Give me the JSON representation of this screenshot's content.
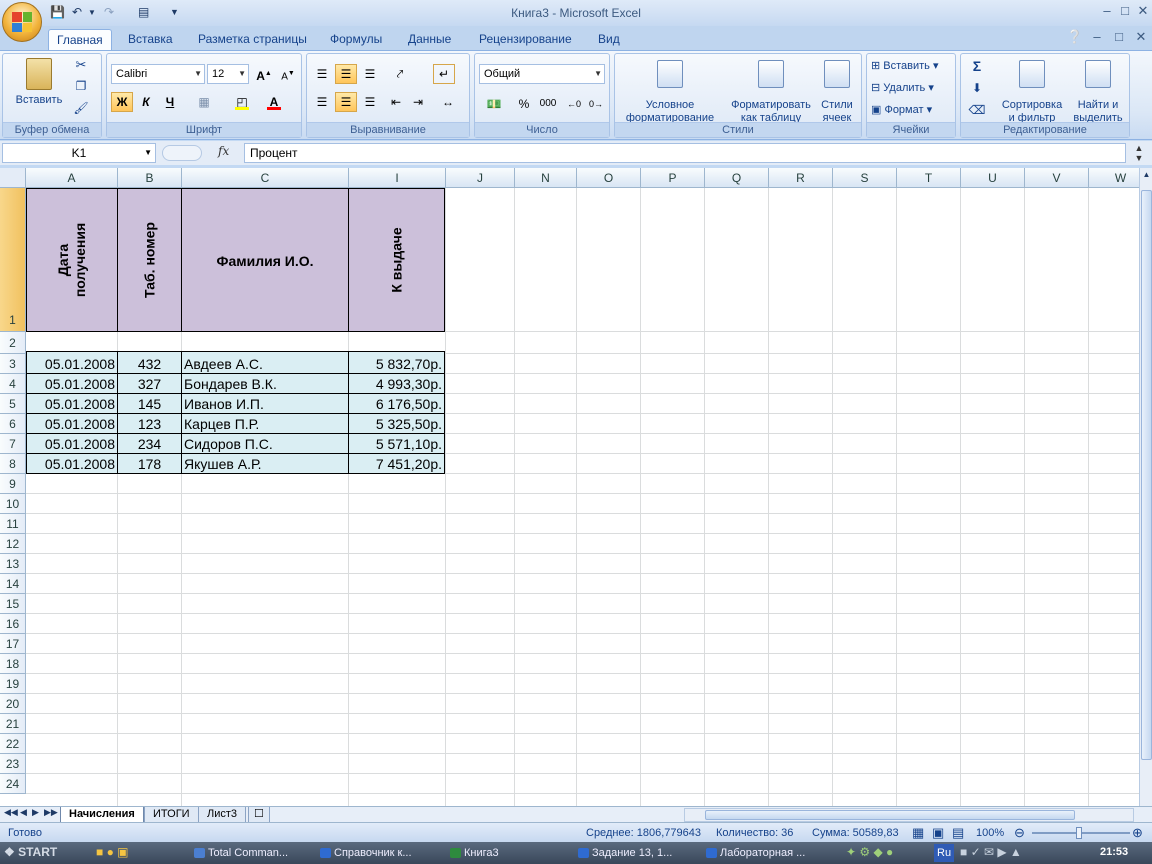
{
  "window": {
    "title": "Книга3 - Microsoft Excel"
  },
  "ribbon": {
    "tabs": [
      "Главная",
      "Вставка",
      "Разметка страницы",
      "Формулы",
      "Данные",
      "Рецензирование",
      "Вид"
    ],
    "active_tab": "Главная",
    "clipboard": {
      "label": "Буфер обмена",
      "paste": "Вставить"
    },
    "font": {
      "label": "Шрифт",
      "name": "Calibri",
      "size": "12",
      "bold": "Ж",
      "italic": "К",
      "underline": "Ч"
    },
    "alignment": {
      "label": "Выравнивание"
    },
    "number": {
      "label": "Число",
      "format": "Общий",
      "percent": "%",
      "thousands": "000"
    },
    "styles": {
      "label": "Стили",
      "conditional": [
        "Условное",
        "форматирование"
      ],
      "as_table": [
        "Форматировать",
        "как таблицу"
      ],
      "cell_styles": [
        "Стили",
        "ячеек"
      ]
    },
    "cells": {
      "label": "Ячейки",
      "insert": "Вставить",
      "delete": "Удалить",
      "format": "Формат"
    },
    "editing": {
      "label": "Редактирование",
      "sort": [
        "Сортировка",
        "и фильтр"
      ],
      "find": [
        "Найти и",
        "выделить"
      ]
    }
  },
  "formula_bar": {
    "name_box": "K1",
    "fx": "fx",
    "value": "Процент"
  },
  "grid": {
    "columns": [
      {
        "name": "A",
        "selected": false
      },
      {
        "name": "B",
        "selected": false
      },
      {
        "name": "C",
        "selected": false
      },
      {
        "name": "I",
        "selected": false
      },
      {
        "name": "J",
        "selected": false
      },
      {
        "name": "N",
        "selected": false
      },
      {
        "name": "O",
        "selected": false
      },
      {
        "name": "P",
        "selected": false
      },
      {
        "name": "Q",
        "selected": false
      },
      {
        "name": "R",
        "selected": false
      },
      {
        "name": "S",
        "selected": false
      },
      {
        "name": "T",
        "selected": false
      },
      {
        "name": "U",
        "selected": false
      },
      {
        "name": "V",
        "selected": false
      },
      {
        "name": "W",
        "selected": false
      }
    ],
    "rows": [
      "1",
      "2",
      "3",
      "4",
      "5",
      "6",
      "7",
      "8",
      "9",
      "10",
      "11",
      "12",
      "13",
      "14",
      "15",
      "16",
      "17",
      "18",
      "19",
      "20",
      "21",
      "22",
      "23",
      "24"
    ],
    "selected_row": "1",
    "headers": {
      "date": [
        "Дата",
        "получения"
      ],
      "tab": "Таб. номер",
      "name": "Фамилия И.О.",
      "pay": "К выдаче"
    },
    "data": [
      {
        "date": "05.01.2008",
        "tab": "432",
        "name": "Авдеев А.С.",
        "pay": "5 832,70р."
      },
      {
        "date": "05.01.2008",
        "tab": "327",
        "name": "Бондарев В.К.",
        "pay": "4 993,30р."
      },
      {
        "date": "05.01.2008",
        "tab": "145",
        "name": "Иванов И.П.",
        "pay": "6 176,50р."
      },
      {
        "date": "05.01.2008",
        "tab": "123",
        "name": "Карцев П.Р.",
        "pay": "5 325,50р."
      },
      {
        "date": "05.01.2008",
        "tab": "234",
        "name": "Сидоров П.С.",
        "pay": "5 571,10р."
      },
      {
        "date": "05.01.2008",
        "tab": "178",
        "name": "Якушев А.Р.",
        "pay": "7 451,20р."
      }
    ]
  },
  "sheets": {
    "tabs": [
      "Начисления",
      "ИТОГИ",
      "Лист3"
    ],
    "active": "Начисления"
  },
  "status": {
    "ready": "Готово",
    "average": "Среднее: 1806,779643",
    "count": "Количество: 36",
    "sum": "Сумма: 50589,83",
    "zoom": "100%"
  },
  "taskbar": {
    "start": "START",
    "items": [
      "Total Comman...",
      "Справочник к...",
      "Книга3",
      "Задание 13, 1...",
      "Лабораторная ..."
    ],
    "lang": "Ru",
    "clock": "21:53"
  },
  "colors": {
    "header_fill": "#ccc0da",
    "data_fill": "#daeef3",
    "ribbon_text": "#15428b"
  }
}
